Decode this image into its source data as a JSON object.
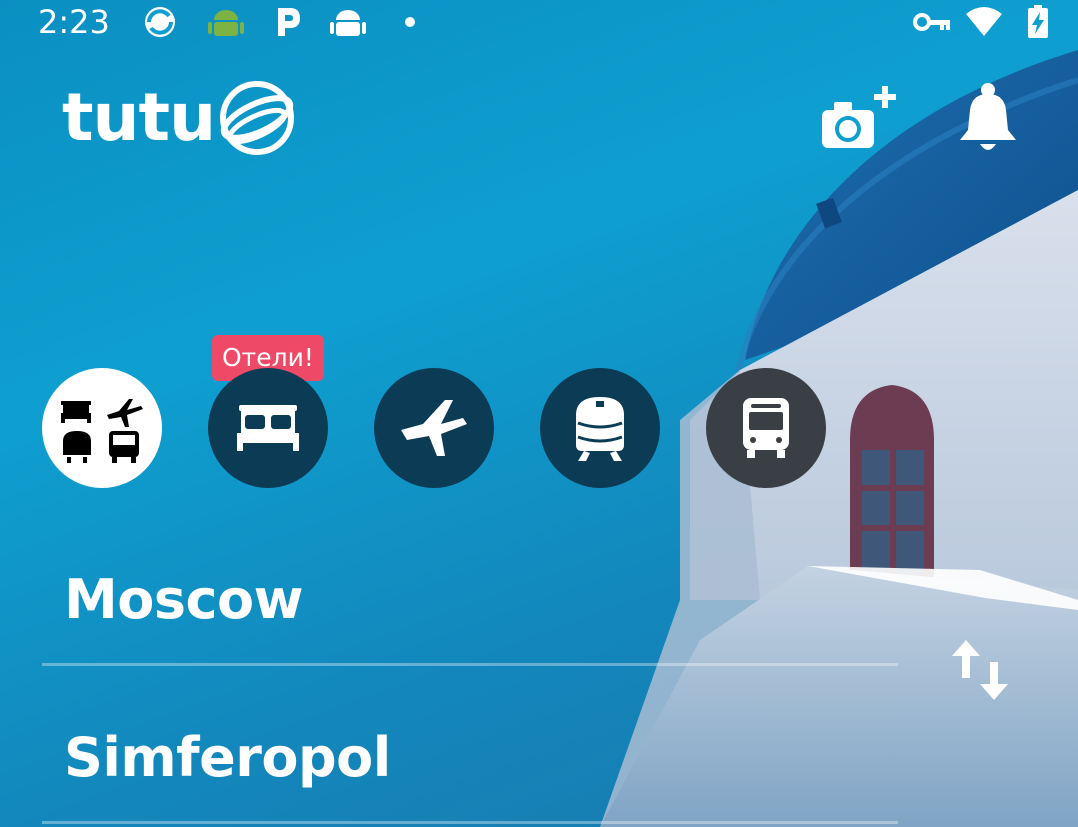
{
  "status_bar": {
    "time": "2:23",
    "icons": [
      "sync-icon",
      "android-icon",
      "parking-icon",
      "android-robot-icon",
      "dot-icon",
      "vpn-key-icon",
      "wifi-icon",
      "battery-charging-icon"
    ]
  },
  "header": {
    "logo_text": "tutu",
    "icons": [
      "add-photo-icon",
      "notification-bell-icon"
    ]
  },
  "categories": {
    "items": [
      {
        "id": "all",
        "icon": "all-transport-icon",
        "selected": true
      },
      {
        "id": "hotels",
        "icon": "bed-icon",
        "selected": false
      },
      {
        "id": "flights",
        "icon": "airplane-icon",
        "selected": false
      },
      {
        "id": "trains",
        "icon": "train-icon",
        "selected": false
      },
      {
        "id": "buses",
        "icon": "bus-icon",
        "selected": false
      }
    ],
    "hotel_badge": "Отели!"
  },
  "route": {
    "from": "Moscow",
    "to": "Simferopol",
    "swap_icon": "swap-vertical-icon"
  },
  "colors": {
    "background": "#0e9fd0",
    "chip": "#0c3c55",
    "chip_selected": "#ffffff",
    "badge": "#ee4a67"
  }
}
